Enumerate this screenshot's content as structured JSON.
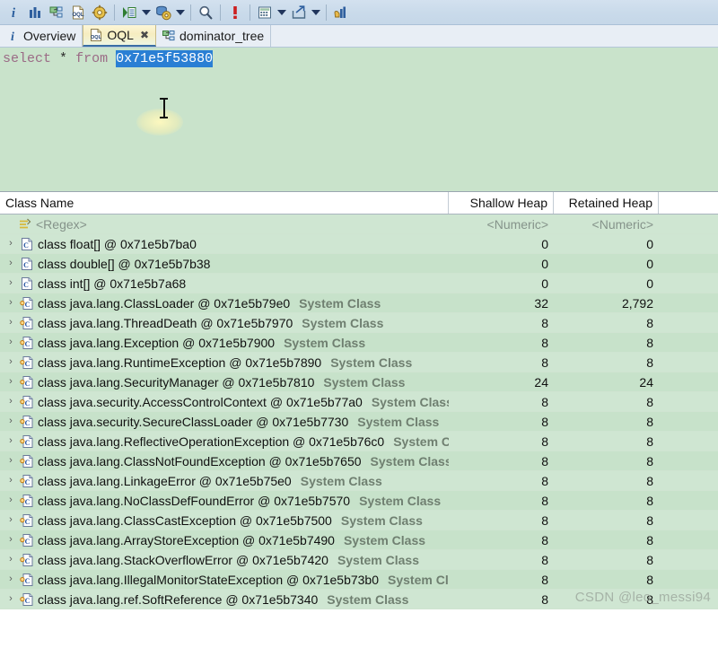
{
  "toolbar": {
    "items": [
      {
        "name": "overview-info-icon",
        "label": "Overview"
      },
      {
        "name": "histogram-icon",
        "label": "Histogram"
      },
      {
        "name": "dominator-tree-icon",
        "label": "Dominator Tree"
      },
      {
        "name": "oql-icon",
        "label": "OQL"
      },
      {
        "name": "settings-gear-icon",
        "label": "Preferences"
      },
      {
        "name": "separator-1",
        "label": ""
      },
      {
        "name": "run-query-icon",
        "label": "Run Query"
      },
      {
        "name": "run-query-dropdown-icon",
        "label": "Run Query Options"
      },
      {
        "name": "heap-dump-tools-icon",
        "label": "Heap Dump Tools"
      },
      {
        "name": "heap-dump-tools-dropdown-icon",
        "label": "Heap Dump Tools Options"
      },
      {
        "name": "separator-2",
        "label": ""
      },
      {
        "name": "search-icon",
        "label": "Find"
      },
      {
        "name": "separator-3",
        "label": ""
      },
      {
        "name": "error-icon",
        "label": "Errors"
      },
      {
        "name": "separator-4",
        "label": ""
      },
      {
        "name": "calculate-icon",
        "label": "Calculate"
      },
      {
        "name": "calculate-dropdown-icon",
        "label": "Calculate Options"
      },
      {
        "name": "export-icon",
        "label": "Export"
      },
      {
        "name": "export-dropdown-icon",
        "label": "Export Options"
      },
      {
        "name": "separator-5",
        "label": ""
      },
      {
        "name": "open-report-icon",
        "label": "Open Report"
      }
    ]
  },
  "tabs": [
    {
      "label": "Overview",
      "icon": "info-icon",
      "active": false,
      "closable": false
    },
    {
      "label": "OQL",
      "icon": "oql-doc-icon",
      "active": true,
      "closable": true,
      "close_glyph": "✖"
    },
    {
      "label": "dominator_tree",
      "icon": "tree-icon",
      "active": false,
      "closable": false
    }
  ],
  "editor": {
    "keyword_select": "select",
    "star": "*",
    "keyword_from": "from",
    "selected_text": "0x71e5f53880",
    "full_query": "select * from 0x71e5f53880"
  },
  "table": {
    "headers": [
      {
        "label": "Class Name",
        "align": "left"
      },
      {
        "label": "Shallow Heap",
        "align": "right"
      },
      {
        "label": "Retained Heap",
        "align": "right"
      }
    ],
    "filter_row": {
      "class_name": "<Regex>",
      "shallow": "<Numeric>",
      "retained": "<Numeric>"
    },
    "rows": [
      {
        "chevron": "›",
        "icon": "class-icon",
        "name": "class float[] @ 0x71e5b7ba0",
        "system": "",
        "shallow": "0",
        "retained": "0"
      },
      {
        "chevron": "›",
        "icon": "class-icon",
        "name": "class double[] @ 0x71e5b7b38",
        "system": "",
        "shallow": "0",
        "retained": "0"
      },
      {
        "chevron": "›",
        "icon": "class-icon",
        "name": "class int[] @ 0x71e5b7a68",
        "system": "",
        "shallow": "0",
        "retained": "0"
      },
      {
        "chevron": "›",
        "icon": "system-class-icon",
        "name": "class java.lang.ClassLoader @ 0x71e5b79e0",
        "system": "System Class",
        "shallow": "32",
        "retained": "2,792"
      },
      {
        "chevron": "›",
        "icon": "system-class-icon",
        "name": "class java.lang.ThreadDeath @ 0x71e5b7970",
        "system": "System Class",
        "shallow": "8",
        "retained": "8"
      },
      {
        "chevron": "›",
        "icon": "system-class-icon",
        "name": "class java.lang.Exception @ 0x71e5b7900",
        "system": "System Class",
        "shallow": "8",
        "retained": "8"
      },
      {
        "chevron": "›",
        "icon": "system-class-icon",
        "name": "class java.lang.RuntimeException @ 0x71e5b7890",
        "system": "System Class",
        "shallow": "8",
        "retained": "8"
      },
      {
        "chevron": "›",
        "icon": "system-class-icon",
        "name": "class java.lang.SecurityManager @ 0x71e5b7810",
        "system": "System Class",
        "shallow": "24",
        "retained": "24"
      },
      {
        "chevron": "›",
        "icon": "system-class-icon",
        "name": "class java.security.AccessControlContext @ 0x71e5b77a0",
        "system": "System Class",
        "shallow": "8",
        "retained": "8"
      },
      {
        "chevron": "›",
        "icon": "system-class-icon",
        "name": "class java.security.SecureClassLoader @ 0x71e5b7730",
        "system": "System Class",
        "shallow": "8",
        "retained": "8"
      },
      {
        "chevron": "›",
        "icon": "system-class-icon",
        "name": "class java.lang.ReflectiveOperationException @ 0x71e5b76c0",
        "system": "System Class",
        "shallow": "8",
        "retained": "8"
      },
      {
        "chevron": "›",
        "icon": "system-class-icon",
        "name": "class java.lang.ClassNotFoundException @ 0x71e5b7650",
        "system": "System Class",
        "shallow": "8",
        "retained": "8"
      },
      {
        "chevron": "›",
        "icon": "system-class-icon",
        "name": "class java.lang.LinkageError @ 0x71e5b75e0",
        "system": "System Class",
        "shallow": "8",
        "retained": "8"
      },
      {
        "chevron": "›",
        "icon": "system-class-icon",
        "name": "class java.lang.NoClassDefFoundError @ 0x71e5b7570",
        "system": "System Class",
        "shallow": "8",
        "retained": "8"
      },
      {
        "chevron": "›",
        "icon": "system-class-icon",
        "name": "class java.lang.ClassCastException @ 0x71e5b7500",
        "system": "System Class",
        "shallow": "8",
        "retained": "8"
      },
      {
        "chevron": "›",
        "icon": "system-class-icon",
        "name": "class java.lang.ArrayStoreException @ 0x71e5b7490",
        "system": "System Class",
        "shallow": "8",
        "retained": "8"
      },
      {
        "chevron": "›",
        "icon": "system-class-icon",
        "name": "class java.lang.StackOverflowError @ 0x71e5b7420",
        "system": "System Class",
        "shallow": "8",
        "retained": "8"
      },
      {
        "chevron": "›",
        "icon": "system-class-icon",
        "name": "class java.lang.IllegalMonitorStateException @ 0x71e5b73b0",
        "system": "System Class",
        "shallow": "8",
        "retained": "8"
      },
      {
        "chevron": "›",
        "icon": "system-class-icon",
        "name": "class java.lang.ref.SoftReference @ 0x71e5b7340",
        "system": "System Class",
        "shallow": "8",
        "retained": "8"
      }
    ]
  },
  "watermark": "CSDN @leo_messi94",
  "colors": {
    "toolbar_bg": "#c9daea",
    "editor_bg": "#c9e3cb",
    "row_odd": "#cfe6d2",
    "row_even": "#c7e2ca",
    "selection_blue": "#2a7fd4",
    "keyword_purple": "#9b6b86",
    "system_class_gray": "#6f7f70",
    "tab_active": "#f6edc0"
  }
}
